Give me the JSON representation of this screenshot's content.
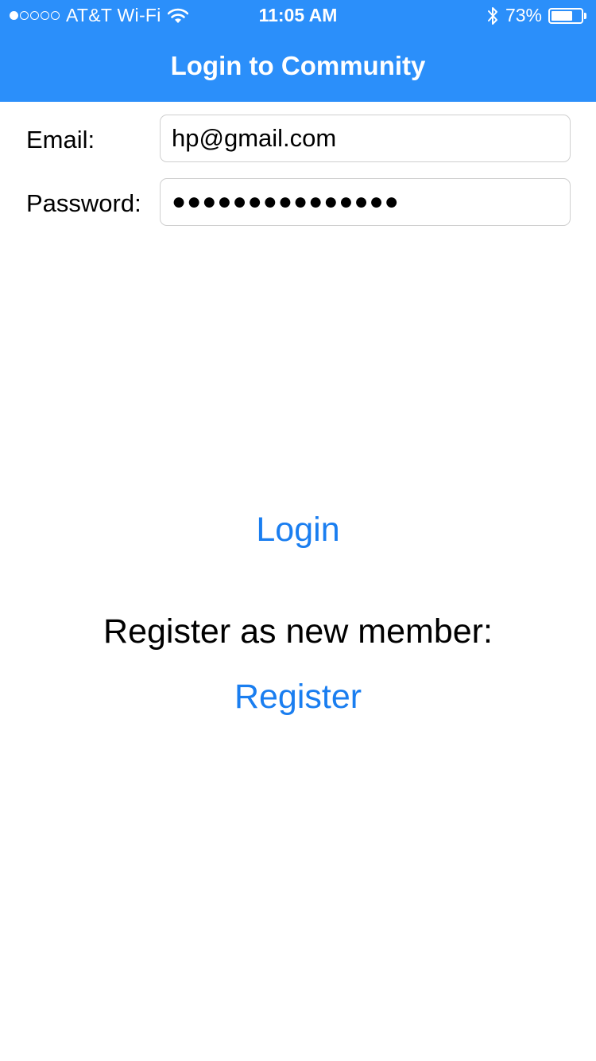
{
  "status_bar": {
    "signal_dots_filled": 1,
    "signal_dots_total": 5,
    "carrier": "AT&T Wi-Fi",
    "time": "11:05 AM",
    "battery_percent_label": "73%",
    "battery_level": 0.73,
    "icons": [
      "wifi-icon",
      "bluetooth-icon",
      "battery-icon"
    ]
  },
  "nav": {
    "title": "Login to Community",
    "background_color": "#2b8ffa"
  },
  "form": {
    "email_label": "Email:",
    "email_value": "hp@gmail.com",
    "password_label": "Password:",
    "password_value": "●●●●●●●●●●●●●●●"
  },
  "actions": {
    "login_label": "Login",
    "register_prompt": "Register as new member:",
    "register_label": "Register",
    "link_color": "#1a7ef0"
  }
}
